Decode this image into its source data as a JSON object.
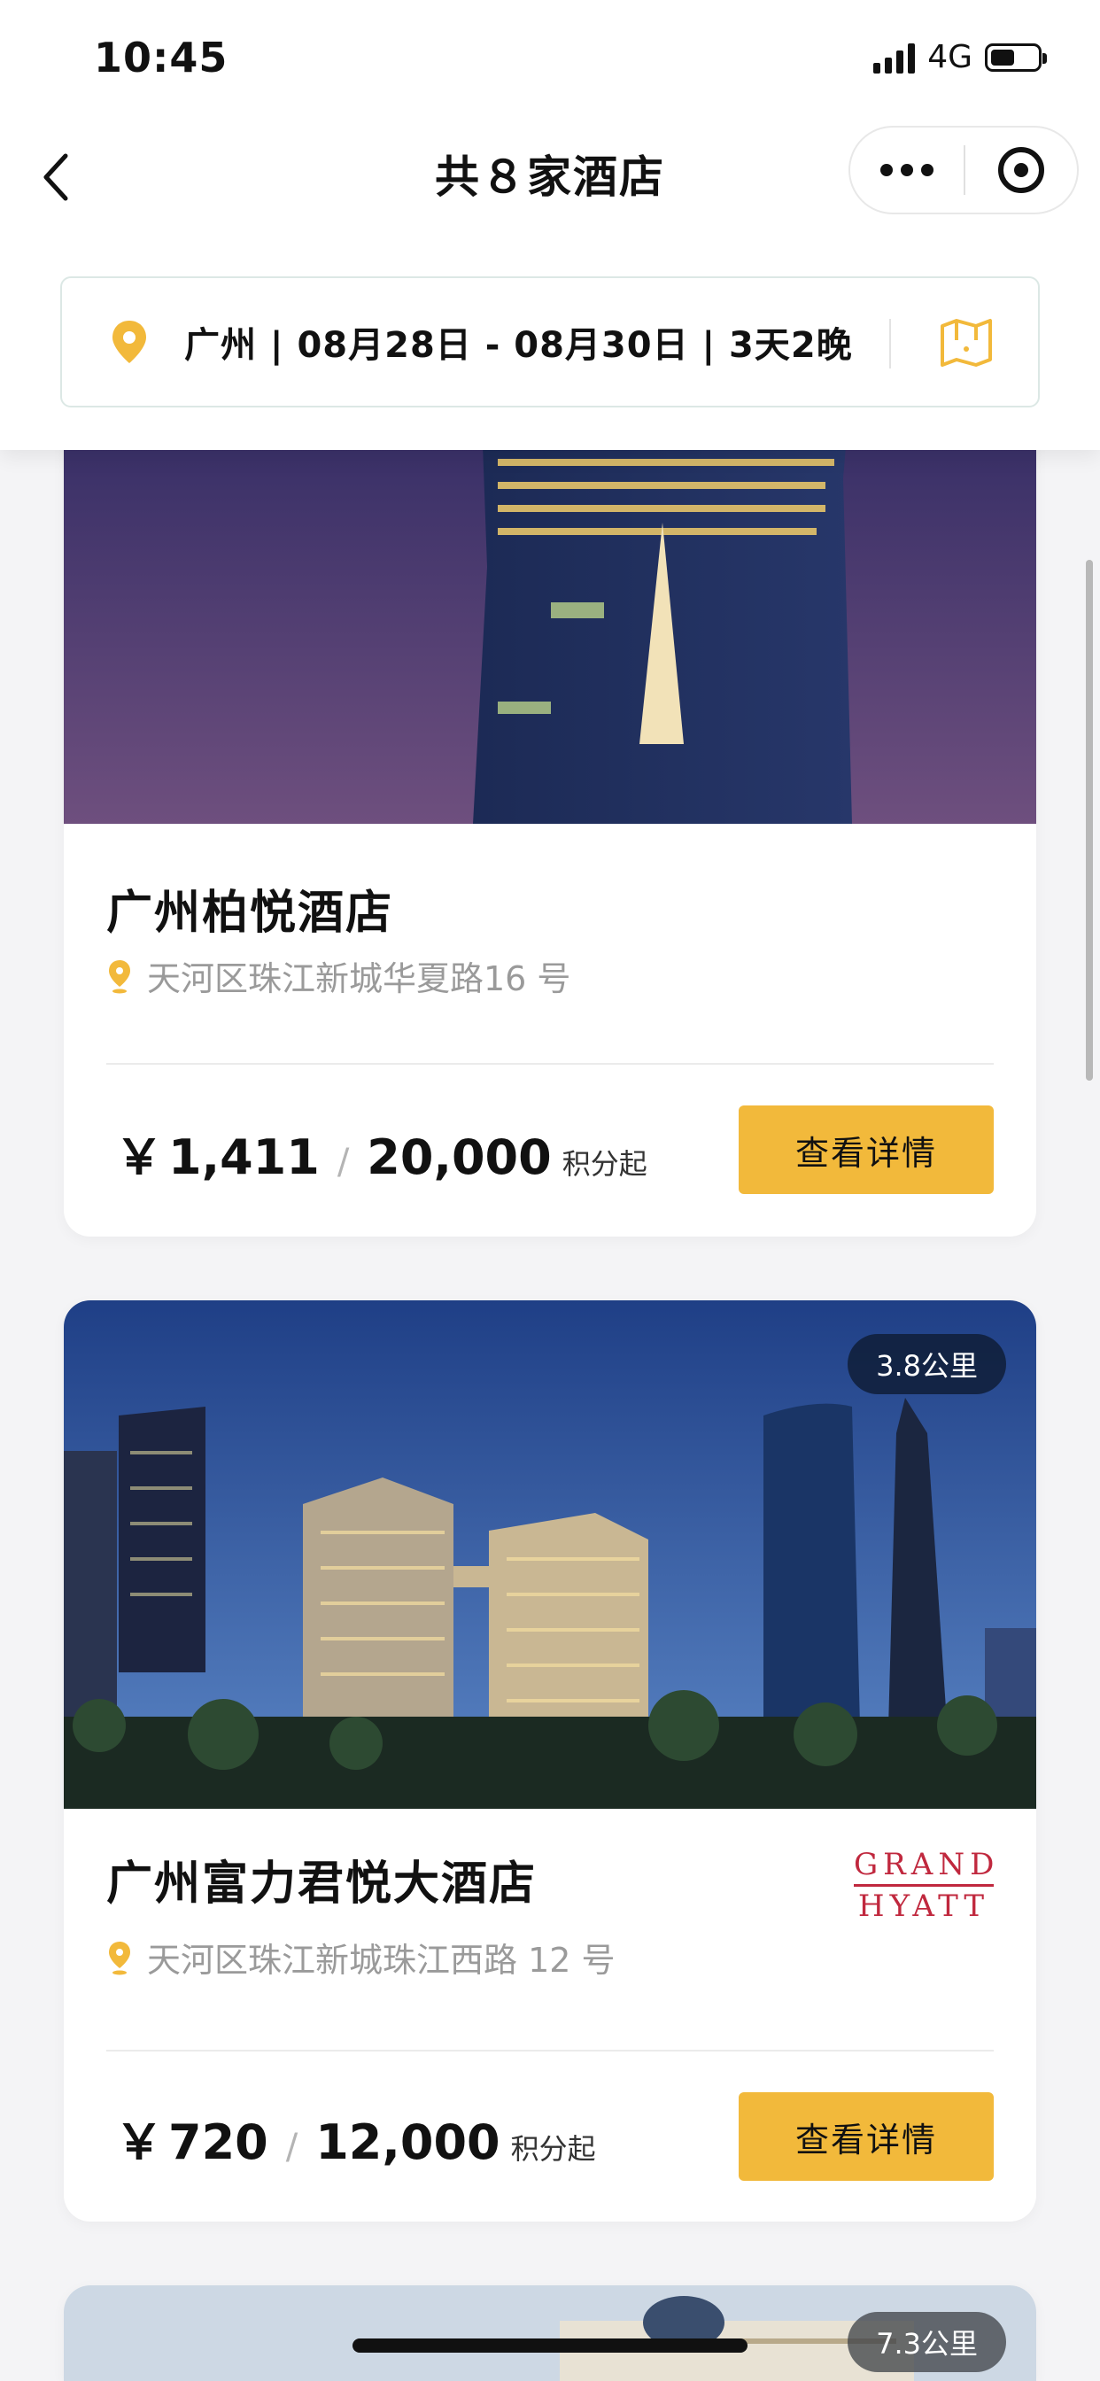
{
  "status": {
    "time": "10:45",
    "network": "4G",
    "battery_level": 0.5
  },
  "nav": {
    "title": "共８家酒店"
  },
  "search": {
    "info": "广州 | 08月28日 - 08月30日 | 3天2晚"
  },
  "hotels": [
    {
      "name": "广州柏悦酒店",
      "address": "天河区珠江新城华夏路16 号",
      "price_yen": "￥",
      "price": "1,411",
      "slash": "/",
      "points": "20,000",
      "points_suffix": "积分起",
      "button": "查看详情"
    },
    {
      "name": "广州富力君悦大酒店",
      "address": "天河区珠江新城珠江西路 12 号",
      "distance": "3.8公里",
      "brand_line1": "GRAND",
      "brand_line2": "HYATT",
      "price_yen": "￥",
      "price": "720",
      "slash": "/",
      "points": "12,000",
      "points_suffix": "积分起",
      "button": "查看详情"
    },
    {
      "distance": "7.3公里"
    }
  ],
  "colors": {
    "accent": "#f2b93b",
    "pin": "#f2b93b",
    "brand": "#c0283e"
  }
}
